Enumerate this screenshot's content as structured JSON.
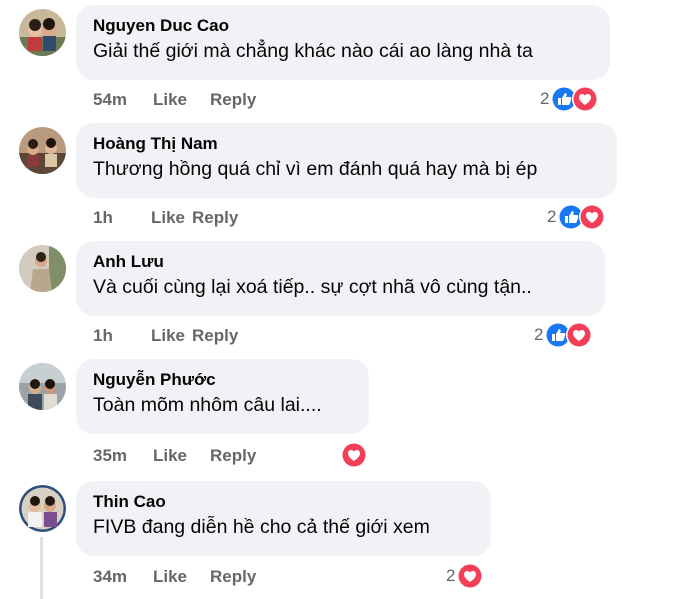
{
  "comments": [
    {
      "author": "Nguyen Duc Cao",
      "text": "Giải thế giới mà chẳng khác nào cái ao làng nhà ta",
      "time": "54m",
      "like": "Like",
      "reply": "Reply",
      "reactions": "2",
      "reaction_types": [
        "like",
        "love"
      ]
    },
    {
      "author": "Hoàng Thị Nam",
      "text": "Thương hồng quá chỉ vì em đánh quá hay mà bị ép",
      "time": "1h",
      "like": "Like",
      "reply": "Reply",
      "reactions": "2",
      "reaction_types": [
        "like",
        "love"
      ]
    },
    {
      "author": "Anh Lưu",
      "text": "Và cuối cùng lại xoá tiếp.. sự cợt nhã vô cùng tận..",
      "time": "1h",
      "like": "Like",
      "reply": "Reply",
      "reactions": "2",
      "reaction_types": [
        "like",
        "love"
      ]
    },
    {
      "author": "Nguyễn Phước",
      "text": "Toàn mõm nhôm câu lai....",
      "time": "35m",
      "like": "Like",
      "reply": "Reply",
      "reactions": "",
      "reaction_types": [
        "love"
      ]
    },
    {
      "author": "Thin Cao",
      "text": "FIVB đang diễn hề cho cả thế giới xem",
      "time": "34m",
      "like": "Like",
      "reply": "Reply",
      "reactions": "2",
      "reaction_types": [
        "love"
      ]
    }
  ],
  "colors": {
    "like_blue": "#1877f2",
    "love_red": "#f33e58",
    "bubble": "#f0f2f5",
    "meta": "#65676b"
  }
}
